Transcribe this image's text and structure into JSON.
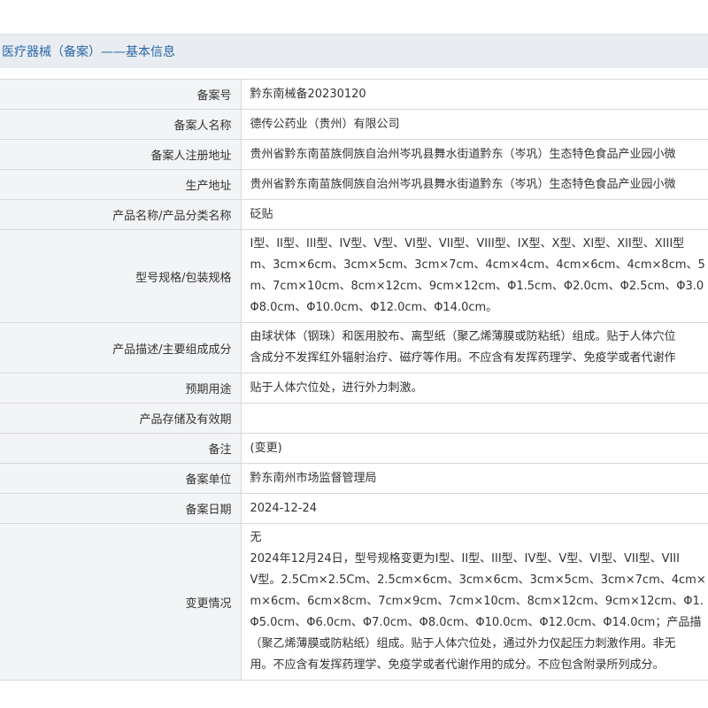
{
  "header": {
    "title": "医疗器械（备案）——基本信息"
  },
  "rows": [
    {
      "label": "备案号",
      "value": [
        "黔东南械备20230120"
      ]
    },
    {
      "label": "备案人名称",
      "value": [
        "德传公药业（贵州）有限公司"
      ]
    },
    {
      "label": "备案人注册地址",
      "value": [
        "贵州省黔东南苗族侗族自治州岑巩县舞水街道黔东（岑巩）生态特色食品产业园小微"
      ]
    },
    {
      "label": "生产地址",
      "value": [
        "贵州省黔东南苗族侗族自治州岑巩县舞水街道黔东（岑巩）生态特色食品产业园小微"
      ]
    },
    {
      "label": "产品名称/产品分类名称",
      "value": [
        "砭贴"
      ]
    },
    {
      "label": "型号规格/包装规格",
      "value": [
        "I型、II型、III型、IV型、V型、VI型、VII型、VIII型、IX型、X型、XI型、XII型、XIII型",
        "m、3cm×6cm、3cm×5cm、3cm×7cm、4cm×4cm、4cm×6cm、4cm×8cm、5",
        "m、7cm×10cm、8cm×12cm、9cm×12cm、Φ1.5cm、Φ2.0cm、Φ2.5cm、Φ3.0",
        "Φ8.0cm、Φ10.0cm、Φ12.0cm、Φ14.0cm。"
      ]
    },
    {
      "label": "产品描述/主要组成成分",
      "value": [
        "由球状体（钢珠）和医用胶布、离型纸（聚乙烯薄膜或防粘纸）组成。贴于人体穴位",
        "含成分不发挥红外辐射治疗、磁疗等作用。不应含有发挥药理学、免疫学或者代谢作"
      ]
    },
    {
      "label": "预期用途",
      "value": [
        "贴于人体穴位处，进行外力刺激。"
      ]
    },
    {
      "label": "产品存储及有效期",
      "value": [
        ""
      ]
    },
    {
      "label": "备注",
      "value": [
        "(变更)"
      ]
    },
    {
      "label": "备案单位",
      "value": [
        "黔东南州市场监督管理局"
      ]
    },
    {
      "label": "备案日期",
      "value": [
        "2024-12-24"
      ]
    },
    {
      "label": "变更情况",
      "value": [
        "无",
        "2024年12月24日，型号规格变更为I型、II型、III型、IV型、V型、VI型、VII型、VIII",
        "V型。2.5Cm×2.5Cm、2.5cm×6cm、3cm×6cm、3cm×5cm、3cm×7cm、4cm×",
        "m×6cm、6cm×8cm、7cm×9cm、7cm×10cm、8cm×12cm、9cm×12cm、Φ1.",
        "Φ5.0cm、Φ6.0cm、Φ7.0cm、Φ8.0cm、Φ10.0cm、Φ12.0cm、Φ14.0cm；产品描",
        "（聚乙烯薄膜或防粘纸）组成。贴于人体穴位处，通过外力仅起压力刺激作用。非无",
        "用。不应含有发挥药理学、免疫学或者代谢作用的成分。不应包含附录所列成分。"
      ]
    }
  ]
}
